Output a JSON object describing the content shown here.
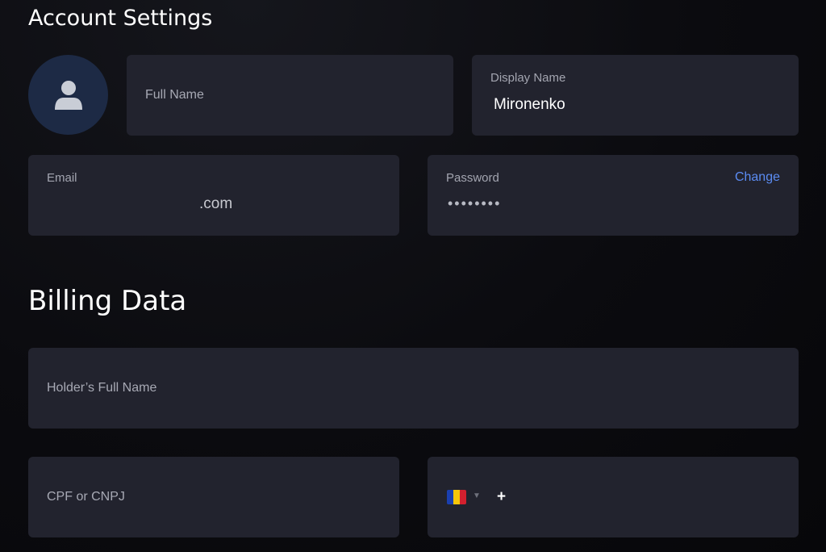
{
  "account": {
    "title": "Account Settings",
    "full_name": {
      "placeholder": "Full Name"
    },
    "display_name": {
      "label": "Display Name",
      "value": "Mironenko"
    },
    "email": {
      "label": "Email",
      "value": ".com"
    },
    "password": {
      "label": "Password",
      "value": "••••••••",
      "change_label": "Change"
    }
  },
  "billing": {
    "title": "Billing Data",
    "holder_name": {
      "placeholder": "Holder’s Full Name"
    },
    "tax_id": {
      "placeholder": "CPF or CNPJ"
    },
    "phone": {
      "flag_icon": "flag-andorra-icon",
      "flag_colors": [
        "#1a3fb0",
        "#f6c60a",
        "#d3202e"
      ],
      "caret_icon": "caret-down-icon",
      "prefix": "+"
    }
  },
  "avatar": {
    "icon": "user-icon",
    "bg_color": "#1d2a45"
  },
  "colors": {
    "accent": "#5b8cf3",
    "card": "#22232e"
  }
}
